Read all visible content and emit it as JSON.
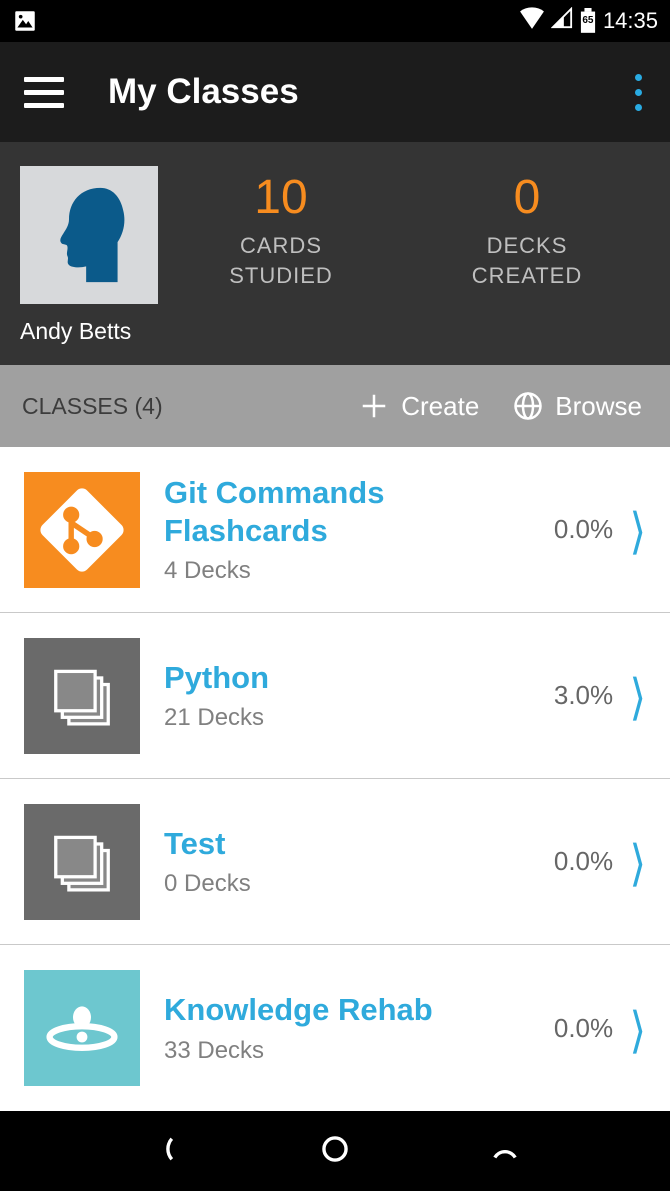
{
  "status": {
    "time": "14:35",
    "battery": "65"
  },
  "app_bar": {
    "title": "My Classes"
  },
  "profile": {
    "name": "Andy Betts",
    "stats": [
      {
        "value": "10",
        "label_l1": "CARDS",
        "label_l2": "STUDIED"
      },
      {
        "value": "0",
        "label_l1": "DECKS",
        "label_l2": "CREATED"
      }
    ]
  },
  "classes_bar": {
    "label": "CLASSES (4)",
    "create": "Create",
    "browse": "Browse"
  },
  "classes": [
    {
      "title": "Git Commands Flashcards",
      "sub": "4 Decks",
      "pct": "0.0%",
      "icon": "git",
      "bg": "ic-orange"
    },
    {
      "title": "Python",
      "sub": "21 Decks",
      "pct": "3.0%",
      "icon": "deck",
      "bg": "ic-gray"
    },
    {
      "title": "Test",
      "sub": "0 Decks",
      "pct": "0.0%",
      "icon": "deck",
      "bg": "ic-gray"
    },
    {
      "title": "Knowledge Rehab",
      "sub": "33 Decks",
      "pct": "0.0%",
      "icon": "orbit",
      "bg": "ic-teal"
    }
  ]
}
